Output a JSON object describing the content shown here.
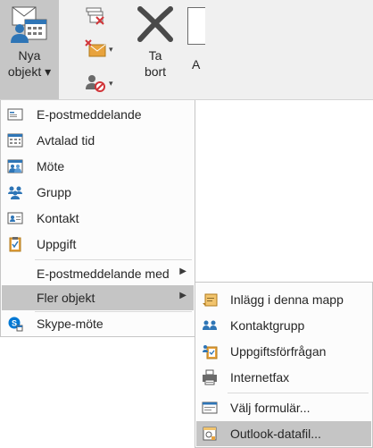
{
  "ribbon": {
    "new_items_line1": "Nya",
    "new_items_line2": "objekt ▾",
    "delete_line1": "Ta",
    "delete_line2": "bort",
    "cut_label": "A"
  },
  "menu": {
    "items": [
      {
        "label": "E-postmeddelande",
        "icon": "email-icon"
      },
      {
        "label": "Avtalad tid",
        "icon": "calendar-icon"
      },
      {
        "label": "Möte",
        "icon": "meeting-icon"
      },
      {
        "label": "Grupp",
        "icon": "group-icon"
      },
      {
        "label": "Kontakt",
        "icon": "contact-card-icon"
      },
      {
        "label": "Uppgift",
        "icon": "task-clipboard-icon"
      },
      {
        "label": "E-postmeddelande med",
        "icon": ""
      },
      {
        "label": "Fler objekt",
        "icon": ""
      },
      {
        "label": "Skype-möte",
        "icon": "skype-meeting-icon"
      }
    ]
  },
  "submenu": {
    "items": [
      {
        "label": "Inlägg i denna mapp",
        "icon": "post-note-icon"
      },
      {
        "label": "Kontaktgrupp",
        "icon": "contact-group-icon"
      },
      {
        "label": "Uppgiftsförfrågan",
        "icon": "task-request-icon"
      },
      {
        "label": "Internetfax",
        "icon": "fax-icon"
      },
      {
        "label": "Välj formulär...",
        "icon": "form-icon"
      },
      {
        "label": "Outlook-datafil...",
        "icon": "data-file-icon"
      }
    ]
  },
  "colors": {
    "highlight": "#c5c5c5",
    "ribbon_bg": "#f0f0f0",
    "accent_blue": "#2e75b6",
    "accent_red": "#d13438",
    "accent_orange": "#e8a33d"
  }
}
